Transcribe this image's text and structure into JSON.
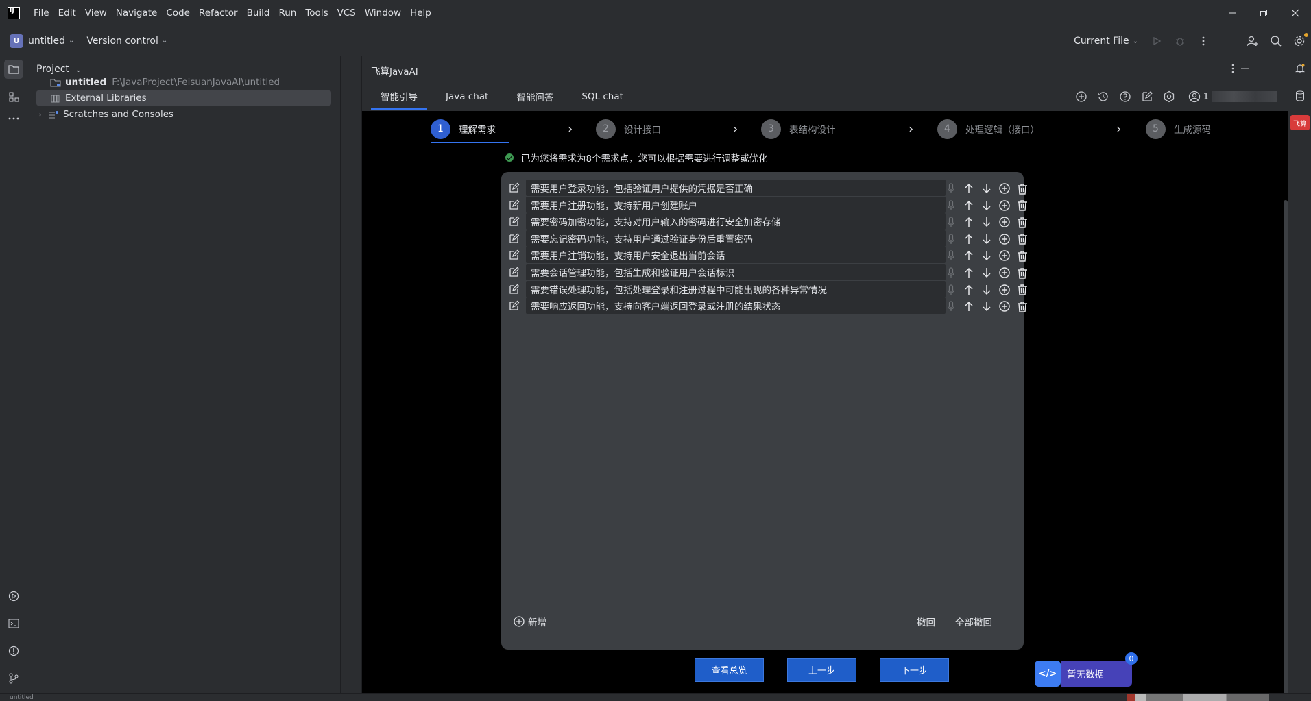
{
  "menubar": {
    "logo": "IJ",
    "items": [
      "File",
      "Edit",
      "View",
      "Navigate",
      "Code",
      "Refactor",
      "Build",
      "Run",
      "Tools",
      "VCS",
      "Window",
      "Help"
    ]
  },
  "toolbar": {
    "project_badge": "U",
    "project_name": "untitled",
    "vcs_label": "Version control",
    "run_config": "Current File"
  },
  "project_panel": {
    "title": "Project",
    "tree": [
      {
        "label": "untitled",
        "path": "F:\\JavaProject\\FeisuanJavaAI\\untitled"
      },
      {
        "label": "External Libraries"
      },
      {
        "label": "Scratches and Consoles"
      }
    ]
  },
  "plugin": {
    "title": "飞算JavaAI",
    "tabs": [
      "智能引导",
      "Java chat",
      "智能问答",
      "SQL chat"
    ],
    "active_tab": 0,
    "user_id": "1",
    "steps": [
      {
        "num": "1",
        "label": "理解需求",
        "active": true
      },
      {
        "num": "2",
        "label": "设计接口",
        "active": false
      },
      {
        "num": "3",
        "label": "表结构设计",
        "active": false
      },
      {
        "num": "4",
        "label": "处理逻辑（接口）",
        "active": false
      },
      {
        "num": "5",
        "label": "生成源码",
        "active": false
      }
    ],
    "info": "已为您将需求为8个需求点，您可以根据需要进行调整或优化",
    "requirements": [
      "需要用户登录功能，包括验证用户提供的凭据是否正确",
      "需要用户注册功能，支持新用户创建账户",
      "需要密码加密功能，支持对用户输入的密码进行安全加密存储",
      "需要忘记密码功能，支持用户通过验证身份后重置密码",
      "需要用户注销功能，支持用户安全退出当前会话",
      "需要会话管理功能，包括生成和验证用户会话标识",
      "需要错误处理功能，包括处理登录和注册过程中可能出现的各种异常情况",
      "需要响应返回功能，支持向客户端返回登录或注册的结果状态"
    ],
    "add_label": "新增",
    "undo_label": "撤回",
    "undo_all_label": "全部撤回",
    "buttons": {
      "overview": "查看总览",
      "prev": "上一步",
      "next": "下一步"
    },
    "nodata": {
      "label": "暂无数据",
      "badge": "0",
      "icon": "</>"
    }
  },
  "right_strip": {
    "badge": "飞算"
  },
  "statusbar": {
    "text": "untitled"
  }
}
